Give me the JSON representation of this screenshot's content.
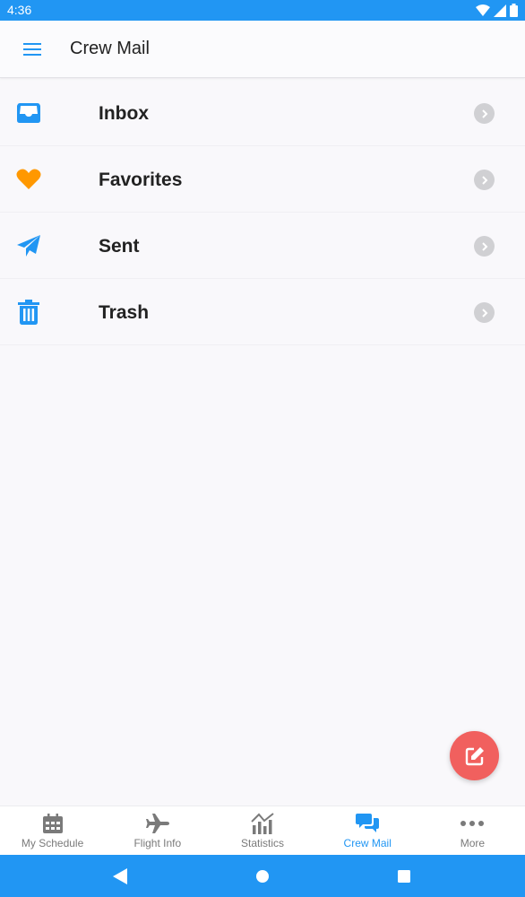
{
  "status_bar": {
    "time": "4:36"
  },
  "header": {
    "title": "Crew Mail"
  },
  "folders": [
    {
      "label": "Inbox",
      "icon": "inbox-icon",
      "color": "#2196f3"
    },
    {
      "label": "Favorites",
      "icon": "heart-icon",
      "color": "#ff9800"
    },
    {
      "label": "Sent",
      "icon": "paper-plane-icon",
      "color": "#2196f3"
    },
    {
      "label": "Trash",
      "icon": "trash-icon",
      "color": "#2196f3"
    }
  ],
  "fab": {
    "icon": "compose-icon",
    "color": "#f1605e"
  },
  "bottom_nav": [
    {
      "label": "My Schedule",
      "icon": "calendar-icon"
    },
    {
      "label": "Flight Info",
      "icon": "airplane-icon"
    },
    {
      "label": "Statistics",
      "icon": "chart-icon"
    },
    {
      "label": "Crew Mail",
      "icon": "chat-icon",
      "active": true
    },
    {
      "label": "More",
      "icon": "more-icon"
    }
  ],
  "colors": {
    "accent": "#2196f3",
    "inactive": "#7a7a7a"
  }
}
